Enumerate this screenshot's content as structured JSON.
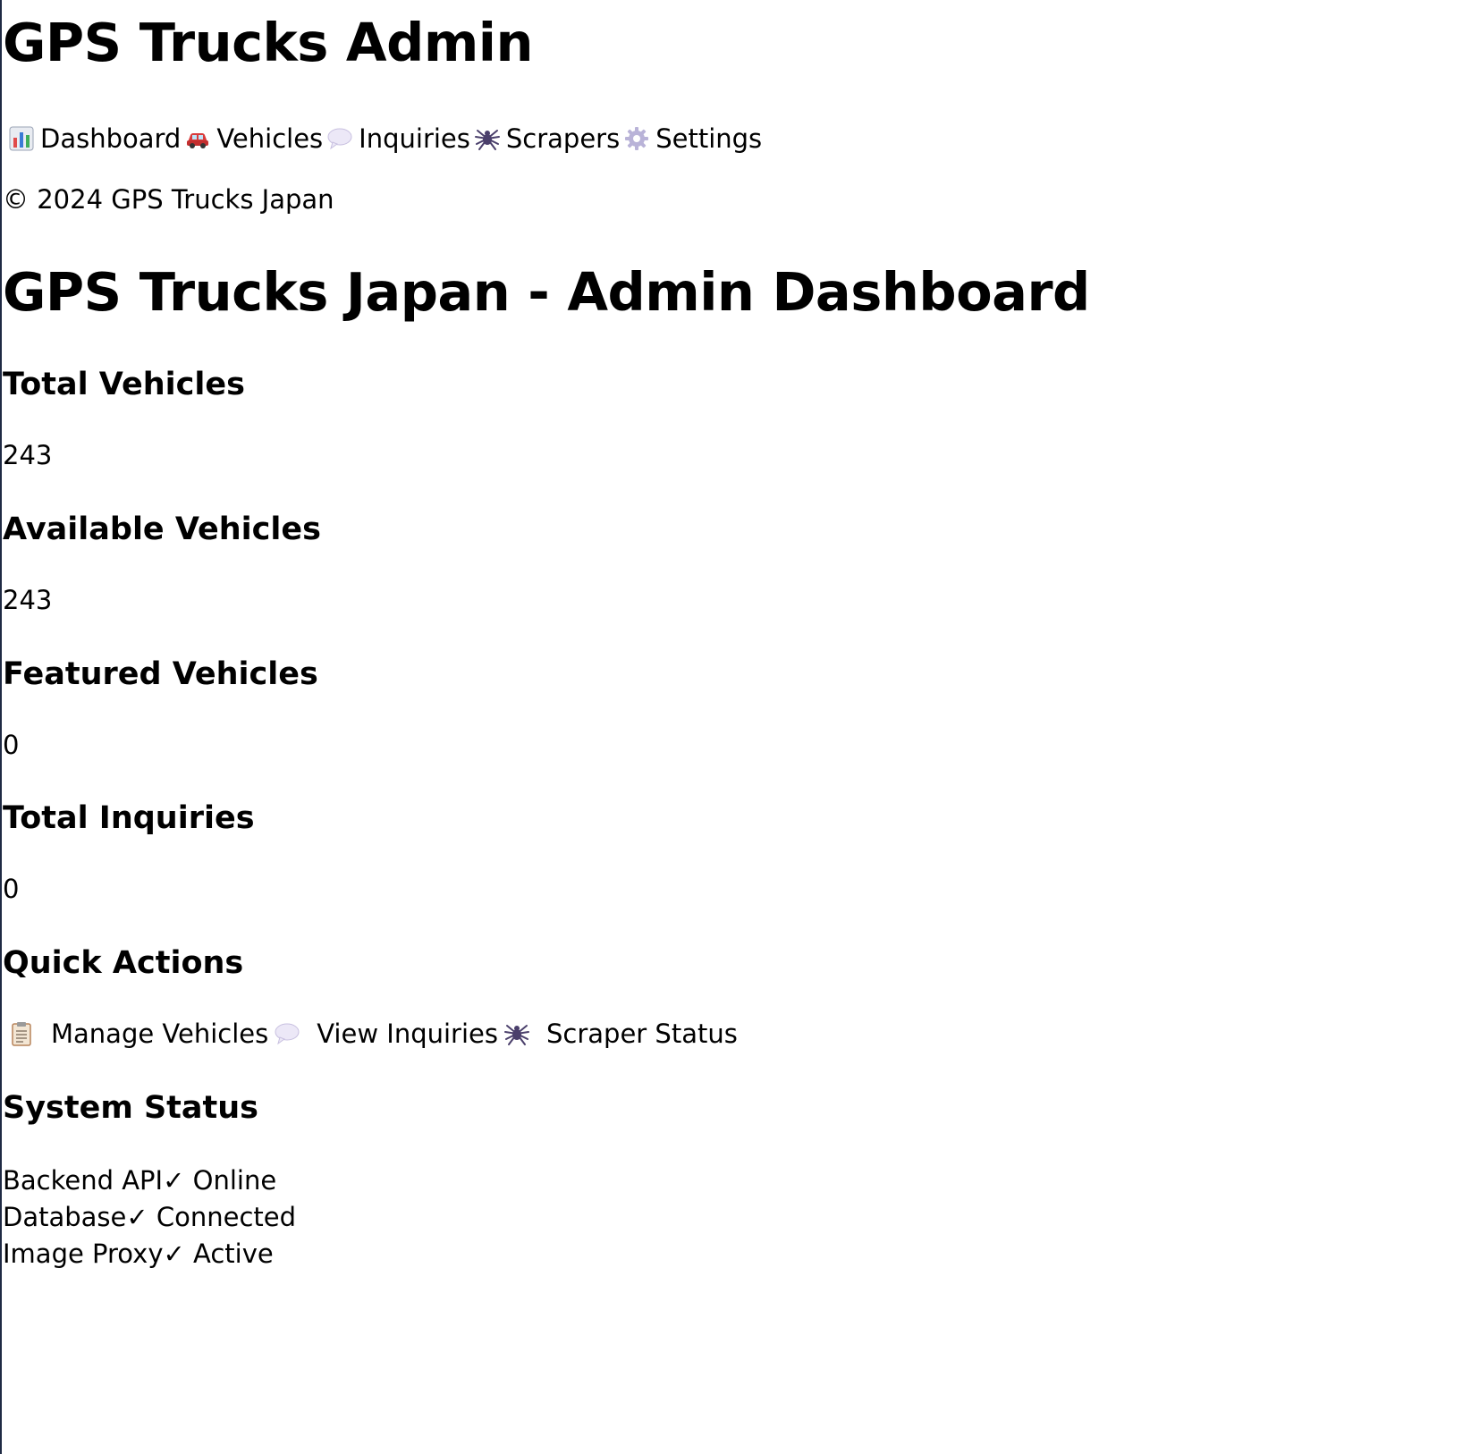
{
  "header": {
    "app_title": "GPS Trucks Admin"
  },
  "nav": {
    "items": [
      {
        "label": "Dashboard",
        "icon": "bar-chart-icon"
      },
      {
        "label": "Vehicles",
        "icon": "car-icon"
      },
      {
        "label": "Inquiries",
        "icon": "speech-bubble-icon"
      },
      {
        "label": "Scrapers",
        "icon": "spider-icon"
      },
      {
        "label": "Settings",
        "icon": "gear-icon"
      }
    ]
  },
  "footer": {
    "copyright": "© 2024 GPS Trucks Japan"
  },
  "dashboard": {
    "title": "GPS Trucks Japan - Admin Dashboard",
    "stats": [
      {
        "label": "Total Vehicles",
        "value": "243"
      },
      {
        "label": "Available Vehicles",
        "value": "243"
      },
      {
        "label": "Featured Vehicles",
        "value": "0"
      },
      {
        "label": "Total Inquiries",
        "value": "0"
      }
    ],
    "quick_actions": {
      "heading": "Quick Actions",
      "items": [
        {
          "label": "Manage Vehicles",
          "icon": "clipboard-icon"
        },
        {
          "label": "View Inquiries",
          "icon": "speech-bubble-icon"
        },
        {
          "label": "Scraper Status",
          "icon": "spider-icon"
        }
      ]
    },
    "system_status": {
      "heading": "System Status",
      "items": [
        {
          "name": "Backend API",
          "status": "✓ Online"
        },
        {
          "name": "Database",
          "status": "✓ Connected"
        },
        {
          "name": "Image Proxy",
          "status": "✓ Active"
        }
      ]
    }
  }
}
